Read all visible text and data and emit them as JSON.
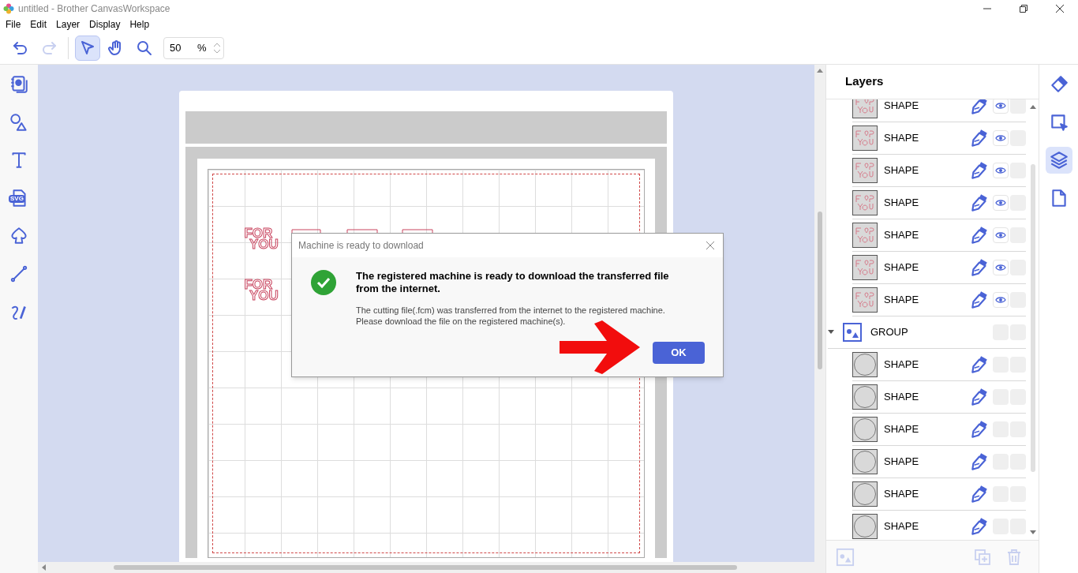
{
  "window": {
    "title": "untitled - Brother CanvasWorkspace"
  },
  "menu": [
    "File",
    "Edit",
    "Layer",
    "Display",
    "Help"
  ],
  "toolbar": {
    "tools": [
      {
        "kind": "undo",
        "disabled": false
      },
      {
        "kind": "redo",
        "disabled": true
      },
      {
        "kind": "select",
        "selected": true
      },
      {
        "kind": "pan",
        "selected": false
      },
      {
        "kind": "zoom",
        "selected": false
      }
    ],
    "zoom_value": "50",
    "zoom_unit": "%"
  },
  "left_tools": [
    {
      "kind": "project"
    },
    {
      "kind": "shapes"
    },
    {
      "kind": "text"
    },
    {
      "kind": "svg",
      "label": "SVG"
    },
    {
      "kind": "outline"
    },
    {
      "kind": "line"
    },
    {
      "kind": "draw"
    }
  ],
  "canvas": {
    "designs": [
      {
        "line1": "FOR",
        "line2": "YOU"
      },
      {
        "line1": "FOR",
        "line2": "YOU"
      }
    ]
  },
  "dialog": {
    "title": "Machine is ready to download",
    "heading": "The registered machine is ready to download the transferred file from the internet.",
    "message": "The cutting file(.fcm) was transferred from the internet to the registered machine. Please download the file on the registered machine(s).",
    "button": "OK"
  },
  "layers": {
    "title": "Layers",
    "items": [
      {
        "kind": "design",
        "name": "SHAPE",
        "visible": true
      },
      {
        "kind": "design",
        "name": "SHAPE",
        "visible": true
      },
      {
        "kind": "design",
        "name": "SHAPE",
        "visible": true
      },
      {
        "kind": "design",
        "name": "SHAPE",
        "visible": true
      },
      {
        "kind": "design",
        "name": "SHAPE",
        "visible": true
      },
      {
        "kind": "design",
        "name": "SHAPE",
        "visible": true
      },
      {
        "kind": "design",
        "name": "SHAPE",
        "visible": true
      },
      {
        "kind": "group",
        "name": "GROUP",
        "expanded": true,
        "children": [
          {
            "kind": "circle",
            "name": "SHAPE",
            "visible": false
          },
          {
            "kind": "circle",
            "name": "SHAPE",
            "visible": false
          },
          {
            "kind": "circle",
            "name": "SHAPE",
            "visible": false
          },
          {
            "kind": "circle",
            "name": "SHAPE",
            "visible": false
          },
          {
            "kind": "circle",
            "name": "SHAPE",
            "visible": false
          },
          {
            "kind": "circle",
            "name": "SHAPE",
            "visible": false
          }
        ]
      }
    ]
  },
  "right_tools": [
    {
      "kind": "brush",
      "selected": false
    },
    {
      "kind": "transform",
      "selected": false
    },
    {
      "kind": "layers",
      "selected": true
    },
    {
      "kind": "page",
      "selected": false
    }
  ]
}
